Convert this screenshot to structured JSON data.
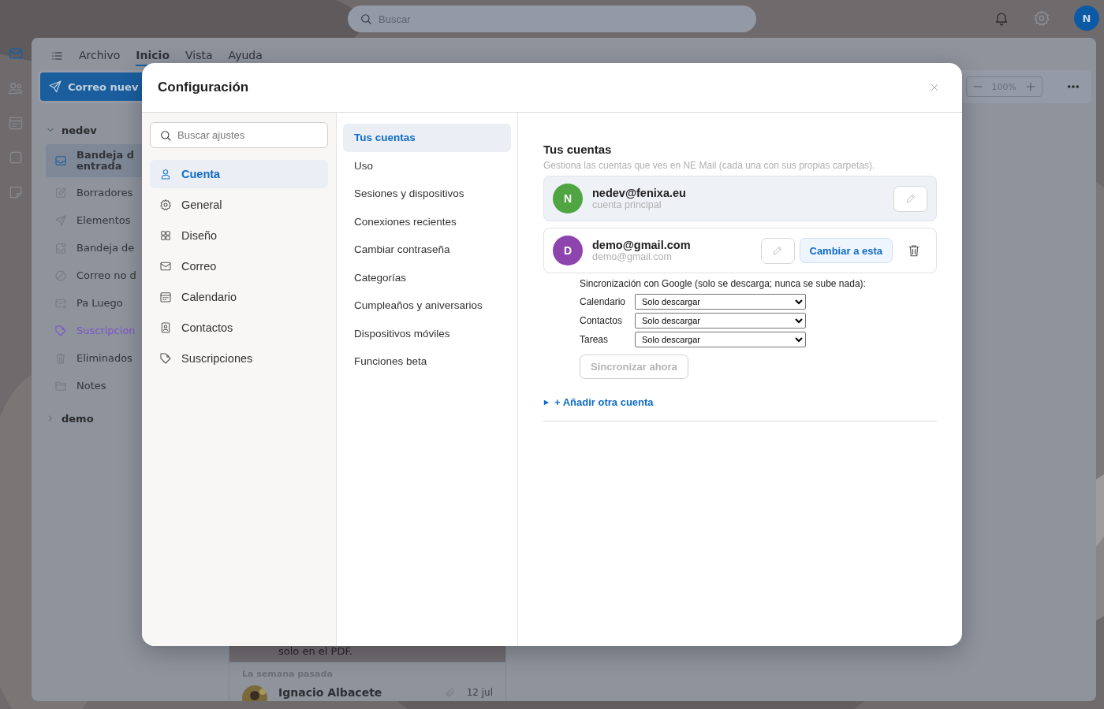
{
  "topbar": {
    "search": {
      "placeholder": "Buscar"
    },
    "avatar": "N"
  },
  "rail": [
    {
      "selected": true
    },
    {
      "selected": false
    },
    {
      "selected": false
    },
    {
      "selected": false
    },
    {
      "selected": false
    }
  ],
  "menu": [
    {
      "label": "Archivo",
      "selected": false
    },
    {
      "label": "Inicio",
      "selected": true
    },
    {
      "label": "Vista",
      "selected": false
    },
    {
      "label": "Ayuda",
      "selected": false
    }
  ],
  "toolbar": {
    "new_button": "Correo nuev",
    "zoom": "100%"
  },
  "folders": [
    {
      "name": "nedev",
      "expanded": true,
      "items": [
        {
          "label": "Bandeja d\nentrada",
          "selected": true
        },
        {
          "label": "Borradores",
          "selected": false
        },
        {
          "label": "Elementos",
          "selected": false
        },
        {
          "label": "Bandeja de",
          "selected": false
        },
        {
          "label": "Correo no d",
          "selected": false
        },
        {
          "label": "Pa Luego",
          "selected": false
        },
        {
          "label": "Suscripcion",
          "selected": false,
          "color": "#7a55c8"
        },
        {
          "label": "Eliminados",
          "selected": false
        },
        {
          "label": "Notes",
          "selected": false
        }
      ]
    },
    {
      "name": "demo",
      "expanded": false
    }
  ],
  "message_list": {
    "preview_tail": "solo en el PDF.",
    "group": "La semana pasada",
    "rows": [
      {
        "sender": "Ignacio Albacete",
        "date": "12 jul",
        "attachment": true
      }
    ]
  },
  "settings": {
    "title": "Configuración",
    "search": {
      "placeholder": "Buscar ajustes"
    },
    "categories": [
      {
        "label": "Cuenta",
        "selected": true
      },
      {
        "label": "General",
        "selected": false
      },
      {
        "label": "Diseño",
        "selected": false
      },
      {
        "label": "Correo",
        "selected": false
      },
      {
        "label": "Calendario",
        "selected": false
      },
      {
        "label": "Contactos",
        "selected": false
      },
      {
        "label": "Suscripciones",
        "selected": false
      }
    ],
    "sections": [
      {
        "label": "Tus cuentas",
        "selected": true
      },
      {
        "label": "Uso",
        "selected": false
      },
      {
        "label": "Sesiones y dispositivos",
        "selected": false
      },
      {
        "label": "Conexiones recientes",
        "selected": false
      },
      {
        "label": "Cambiar contraseña",
        "selected": false
      },
      {
        "label": "Categorías",
        "selected": false
      },
      {
        "label": "Cumpleaños y aniversarios",
        "selected": false
      },
      {
        "label": "Dispositivos móviles",
        "selected": false
      },
      {
        "label": "Funciones beta",
        "selected": false
      }
    ],
    "content": {
      "title": "Tus cuentas",
      "subtitle": "Gestiona las cuentas que ves en NE Mail (cada una con sus propias carpetas).",
      "accounts": [
        {
          "initial": "N",
          "color": "#4ea542",
          "email": "nedev@fenixa.eu",
          "detail": "cuenta principal",
          "active": true
        },
        {
          "initial": "D",
          "color": "#8e44ad",
          "email": "demo@gmail.com",
          "detail": "demo@gmail.com",
          "active": false,
          "switch_label": "Cambiar a esta",
          "sync": {
            "heading": "Sincronización con Google (solo se descarga; nunca se sube nada):",
            "rows": [
              {
                "label": "Calendario",
                "value": "Solo descargar"
              },
              {
                "label": "Contactos",
                "value": "Solo descargar"
              },
              {
                "label": "Tareas",
                "value": "Solo descargar"
              }
            ],
            "button": {
              "label": "Sincronizar ahora",
              "disabled": true
            }
          }
        }
      ],
      "add_account": {
        "label": "+ Añadir otra cuenta",
        "expanded": false
      }
    }
  }
}
